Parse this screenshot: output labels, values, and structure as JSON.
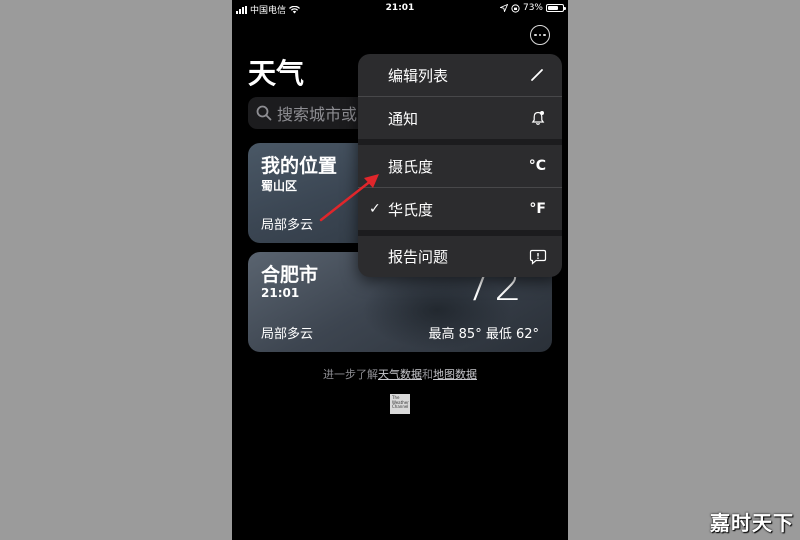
{
  "status_bar": {
    "carrier": "中国电信",
    "time": "21:01",
    "battery": "73%",
    "battery_level": 0.73
  },
  "header": {
    "title": "天气"
  },
  "search": {
    "placeholder": "搜索城市或"
  },
  "cards": [
    {
      "name": "我的位置",
      "sub": "蜀山区",
      "condition": "局部多云"
    },
    {
      "name": "合肥市",
      "sub": "21:01",
      "temp": "72",
      "condition": "局部多云",
      "high_low": "最高 85° 最低 62°"
    }
  ],
  "footer": {
    "prefix": "进一步了解",
    "link1": "天气数据",
    "mid": "和",
    "link2": "地图数据"
  },
  "logo": {
    "line1": "The",
    "line2": "Weather",
    "line3": "Channel"
  },
  "menu": {
    "items": [
      {
        "label": "编辑列表",
        "icon": "pencil-icon"
      },
      {
        "label": "通知",
        "icon": "bell-icon"
      },
      {
        "label": "摄氏度",
        "icon_text": "°C"
      },
      {
        "label": "华氏度",
        "icon_text": "°F",
        "checked": true
      },
      {
        "label": "报告问题",
        "icon": "report-bubble-icon"
      }
    ]
  },
  "watermark": "嘉时天下",
  "colors": {
    "arrow": "#e0262b",
    "menu_bg": "#2c2c2e",
    "background": "#9b9b9b"
  }
}
